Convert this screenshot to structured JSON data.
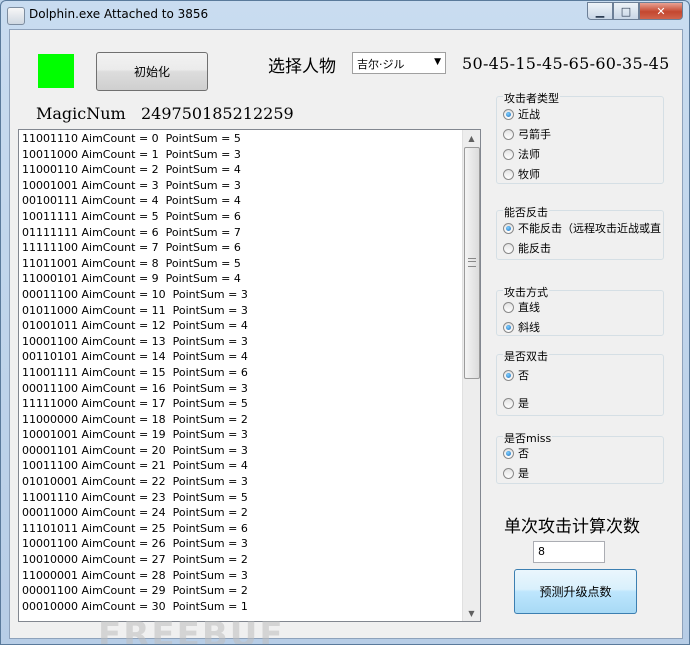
{
  "window": {
    "title": "Dolphin.exe Attached to 3856",
    "minimize_glyph": "▁",
    "maximize_glyph": "□",
    "close_glyph": "✕"
  },
  "indicator": {
    "color": "#00ff00"
  },
  "init_button": {
    "label": "初始化"
  },
  "character": {
    "label": "选择人物",
    "selected": "吉尔·ジル"
  },
  "hex_value": "50-45-15-45-65-60-35-45",
  "magic": {
    "label": "MagicNum",
    "value": "249750185212259"
  },
  "list": {
    "rows": [
      "11001110 AimCount = 0  PointSum = 5",
      "10011000 AimCount = 1  PointSum = 3",
      "11000110 AimCount = 2  PointSum = 4",
      "10001001 AimCount = 3  PointSum = 3",
      "00100111 AimCount = 4  PointSum = 4",
      "10011111 AimCount = 5  PointSum = 6",
      "01111111 AimCount = 6  PointSum = 7",
      "11111100 AimCount = 7  PointSum = 6",
      "11011001 AimCount = 8  PointSum = 5",
      "11000101 AimCount = 9  PointSum = 4",
      "00011100 AimCount = 10  PointSum = 3",
      "01011000 AimCount = 11  PointSum = 3",
      "01001011 AimCount = 12  PointSum = 4",
      "10001100 AimCount = 13  PointSum = 3",
      "00110101 AimCount = 14  PointSum = 4",
      "11001111 AimCount = 15  PointSum = 6",
      "00011100 AimCount = 16  PointSum = 3",
      "11111000 AimCount = 17  PointSum = 5",
      "11000000 AimCount = 18  PointSum = 2",
      "10001001 AimCount = 19  PointSum = 3",
      "00001101 AimCount = 20  PointSum = 3",
      "10011100 AimCount = 21  PointSum = 4",
      "01010001 AimCount = 22  PointSum = 3",
      "11001110 AimCount = 23  PointSum = 5",
      "00011000 AimCount = 24  PointSum = 2",
      "11101011 AimCount = 25  PointSum = 6",
      "10001100 AimCount = 26  PointSum = 3",
      "10010000 AimCount = 27  PointSum = 2",
      "11000001 AimCount = 28  PointSum = 3",
      "00001100 AimCount = 29  PointSum = 2",
      "00010000 AimCount = 30  PointSum = 1"
    ]
  },
  "attacker_type": {
    "title": "攻击者类型",
    "options": [
      "近战",
      "弓箭手",
      "法师",
      "牧师"
    ],
    "selected_index": 0
  },
  "counter": {
    "title": "能否反击",
    "options": [
      "不能反击（远程攻击近战或直",
      "能反击"
    ],
    "selected_index": 0
  },
  "attack_mode": {
    "title": "攻击方式",
    "options": [
      "直线",
      "斜线"
    ],
    "selected_index": 1
  },
  "double_hit": {
    "title": "是否双击",
    "options": [
      "否",
      "是"
    ],
    "selected_index": 0
  },
  "miss": {
    "title": "是否miss",
    "options": [
      "否",
      "是"
    ],
    "selected_index": 0
  },
  "single_attack": {
    "label": "单次攻击计算次数",
    "value": "8"
  },
  "predict_button": {
    "label": "预测升级点数"
  },
  "watermark": "FREEBUF"
}
